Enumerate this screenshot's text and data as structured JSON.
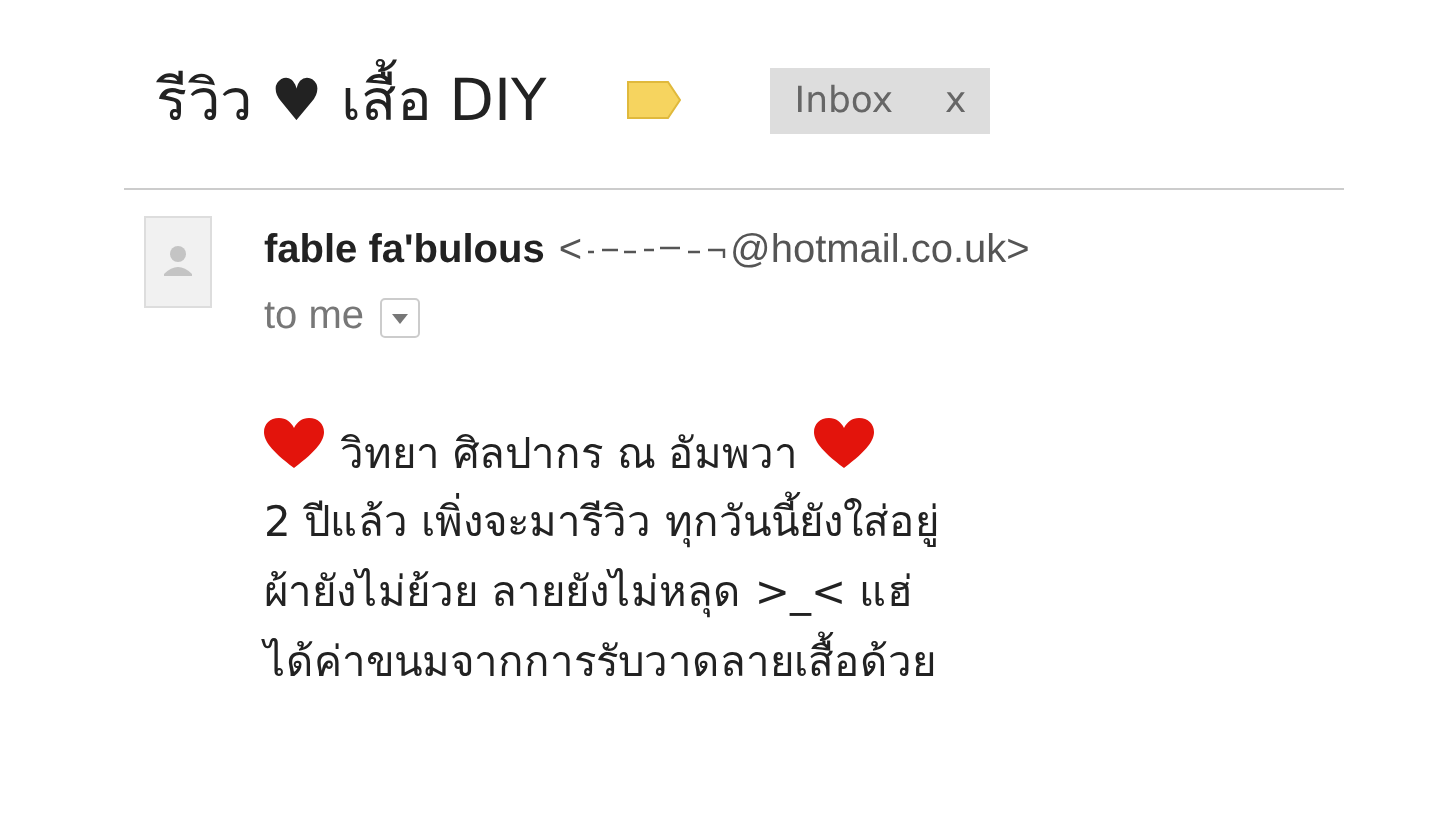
{
  "subject": "รีวิว ♥ เสื้อ DIY",
  "labels": [
    {
      "text": "Inbox",
      "remove": "x"
    }
  ],
  "sender": {
    "name": "fable fa'bulous",
    "email_open": "<",
    "email_domain": "@hotmail.co.uk>",
    "recipient": "to me"
  },
  "body": {
    "heading": "วิทยา ศิลปากร ณ อัมพวา",
    "lines": [
      "2 ปีแล้ว เพิ่งจะมารีวิว ทุกวันนี้ยังใส่อยู่",
      "ผ้ายังไม่ย้วย ลายยังไม่หลุด >_< แฮ่",
      "ได้ค่าขนมจากการรับวาดลายเสื้อด้วย"
    ]
  }
}
